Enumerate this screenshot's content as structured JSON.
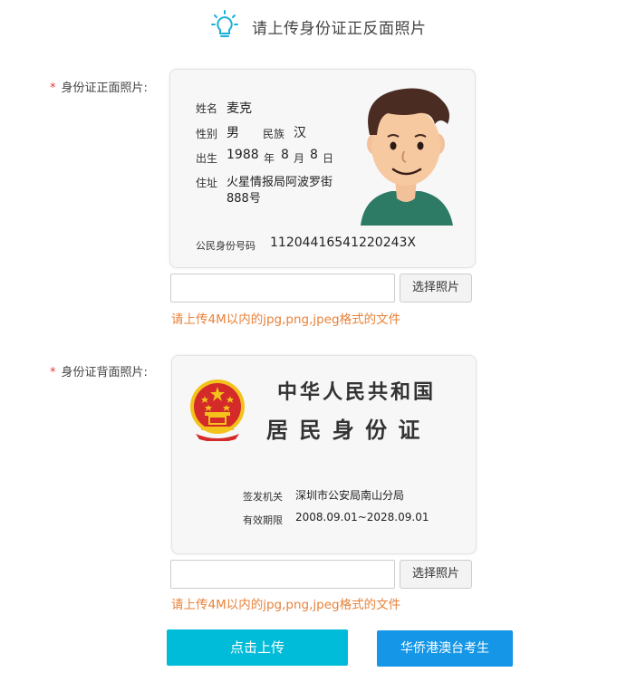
{
  "header": {
    "title": "请上传身份证正反面照片",
    "icon": "lightbulb-icon",
    "icon_color": "#1ab0d8"
  },
  "front": {
    "label": "身份证正面照片:",
    "required_mark": "*",
    "card": {
      "name_label": "姓名",
      "name_value": "麦克",
      "gender_label": "性别",
      "gender_value": "男",
      "ethnic_label": "民族",
      "ethnic_value": "汉",
      "birth_label": "出生",
      "birth_year": "1988",
      "year_unit": "年",
      "birth_month": "8",
      "month_unit": "月",
      "birth_day": "8",
      "day_unit": "日",
      "address_label": "住址",
      "address_line1": "火星情报局阿波罗街",
      "address_line2": "888号",
      "id_label": "公民身份号码",
      "id_value": "11204416541220243X",
      "portrait": "cartoon-avatar"
    },
    "choose_label": "选择照片",
    "hint": "请上传4M以内的jpg,png,jpeg格式的文件",
    "file_value": ""
  },
  "back": {
    "label": "身份证背面照片:",
    "required_mark": "*",
    "card": {
      "title1": "中华人民共和国",
      "title2": "居 民 身 份 证",
      "authority_label": "签发机关",
      "authority_value": "深圳市公安局南山分局",
      "validity_label": "有效期限",
      "validity_value": "2008.09.01~2028.09.01",
      "emblem": "national-emblem"
    },
    "choose_label": "选择照片",
    "hint": "请上传4M以内的jpg,png,jpeg格式的文件",
    "file_value": ""
  },
  "actions": {
    "upload_label": "点击上传",
    "overseas_label": "华侨港澳台考生"
  },
  "colors": {
    "required": "#e4393c",
    "hint": "#e8823a",
    "upload_bg": "#00bcd8",
    "overseas_bg": "#1596e6",
    "emblem_red": "#d42a2a",
    "emblem_gold": "#f3c21b"
  }
}
